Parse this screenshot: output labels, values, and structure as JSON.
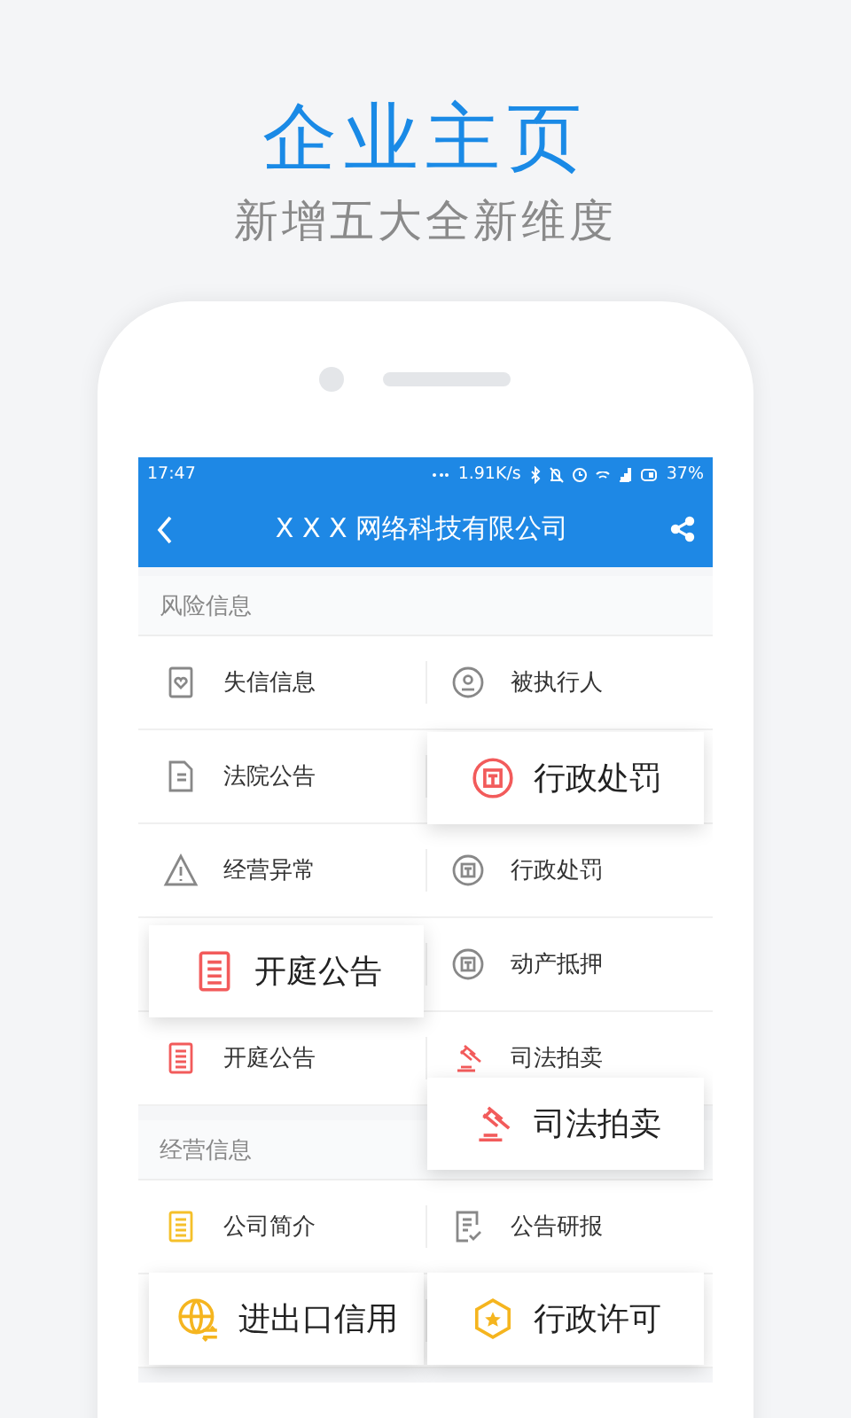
{
  "headline": {
    "title": "企业主页",
    "subtitle": "新增五大全新维度"
  },
  "status_bar": {
    "time": "17:47",
    "speed": "1.91K/s",
    "battery": "37%"
  },
  "nav_bar": {
    "title": "X X X 网络科技有限公司"
  },
  "sections": [
    {
      "title": "风险信息",
      "rows": [
        [
          {
            "label": "失信信息",
            "kind": "heart-doc",
            "color": "#888888"
          },
          {
            "label": "被执行人",
            "kind": "person",
            "color": "#888888"
          }
        ],
        [
          {
            "label": "法院公告",
            "kind": "doc",
            "color": "#888888"
          },
          null
        ],
        [
          {
            "label": "经营异常",
            "kind": "warning",
            "color": "#888888"
          },
          {
            "label": "行政处罚",
            "kind": "seal",
            "color": "#888888"
          }
        ],
        [
          null,
          {
            "label": "动产抵押",
            "kind": "seal",
            "color": "#888888"
          }
        ],
        [
          {
            "label": "开庭公告",
            "kind": "list",
            "color": "#f25b5b"
          },
          {
            "label": "司法拍卖",
            "kind": "gavel",
            "color": "#f25b5b"
          }
        ]
      ]
    },
    {
      "title": "经营信息",
      "rows": [
        [
          {
            "label": "公司简介",
            "kind": "list",
            "color": "#f5c02a"
          },
          {
            "label": "公告研报",
            "kind": "check-doc",
            "color": "#888888"
          }
        ],
        [
          null,
          null
        ]
      ]
    }
  ],
  "highlights": [
    {
      "label": "行政处罚",
      "kind": "seal",
      "color": "#f25b5b"
    },
    {
      "label": "开庭公告",
      "kind": "list",
      "color": "#f25b5b"
    },
    {
      "label": "司法拍卖",
      "kind": "gavel",
      "color": "#f25b5b"
    },
    {
      "label": "进出口信用",
      "kind": "globe",
      "color": "#f5b51f"
    },
    {
      "label": "行政许可",
      "kind": "shield",
      "color": "#f5b51f"
    }
  ]
}
